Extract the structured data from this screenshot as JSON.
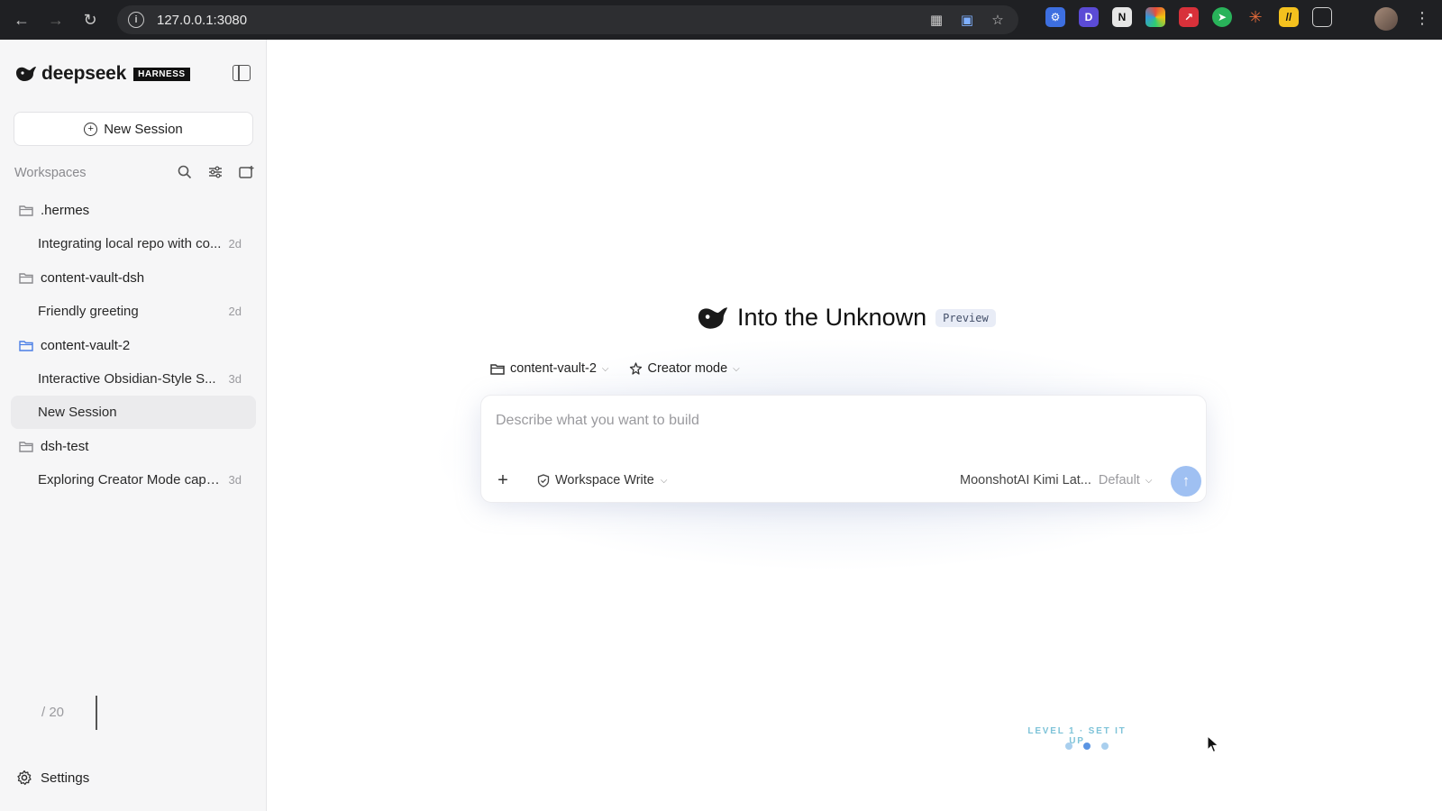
{
  "browser": {
    "url": "127.0.0.1:3080",
    "back_icon": "arrow-left-icon",
    "forward_icon": "arrow-right-icon",
    "reload_icon": "reload-icon"
  },
  "sidebar": {
    "brand_name": "deepseek",
    "brand_badge": "HARNESS",
    "new_session_label": "New Session",
    "workspaces_label": "Workspaces",
    "workspaces": [
      {
        "name": ".hermes",
        "color": "#8a8a8e",
        "sessions": [
          {
            "title": "Integrating local repo with co...",
            "age": "2d"
          }
        ]
      },
      {
        "name": "content-vault-dsh",
        "color": "#8a8a8e",
        "sessions": [
          {
            "title": "Friendly greeting",
            "age": "2d"
          }
        ]
      },
      {
        "name": "content-vault-2",
        "color": "#4a7ee6",
        "sessions": [
          {
            "title": "Interactive Obsidian-Style S...",
            "age": "3d"
          },
          {
            "title": "New Session",
            "age": ""
          }
        ]
      },
      {
        "name": "dsh-test",
        "color": "#8a8a8e",
        "sessions": [
          {
            "title": "Exploring Creator Mode capa...",
            "age": "3d"
          }
        ]
      }
    ],
    "page_counter": "/ 20",
    "settings_label": "Settings"
  },
  "main": {
    "title": "Into the Unknown",
    "badge": "Preview",
    "workspace_selector": "content-vault-2",
    "mode_selector": "Creator mode",
    "prompt_placeholder": "Describe what you want to build",
    "prompt_value": "",
    "permission": "Workspace Write",
    "model": "MoonshotAI Kimi Lat...",
    "model_variant": "Default",
    "level_label": "LEVEL 1 · SET IT UP",
    "progress_step": 2,
    "progress_total": 3
  },
  "colors": {
    "accent": "#4a7ee6",
    "send_button": "#9fc0f2",
    "level_text": "#7ec3d8"
  }
}
